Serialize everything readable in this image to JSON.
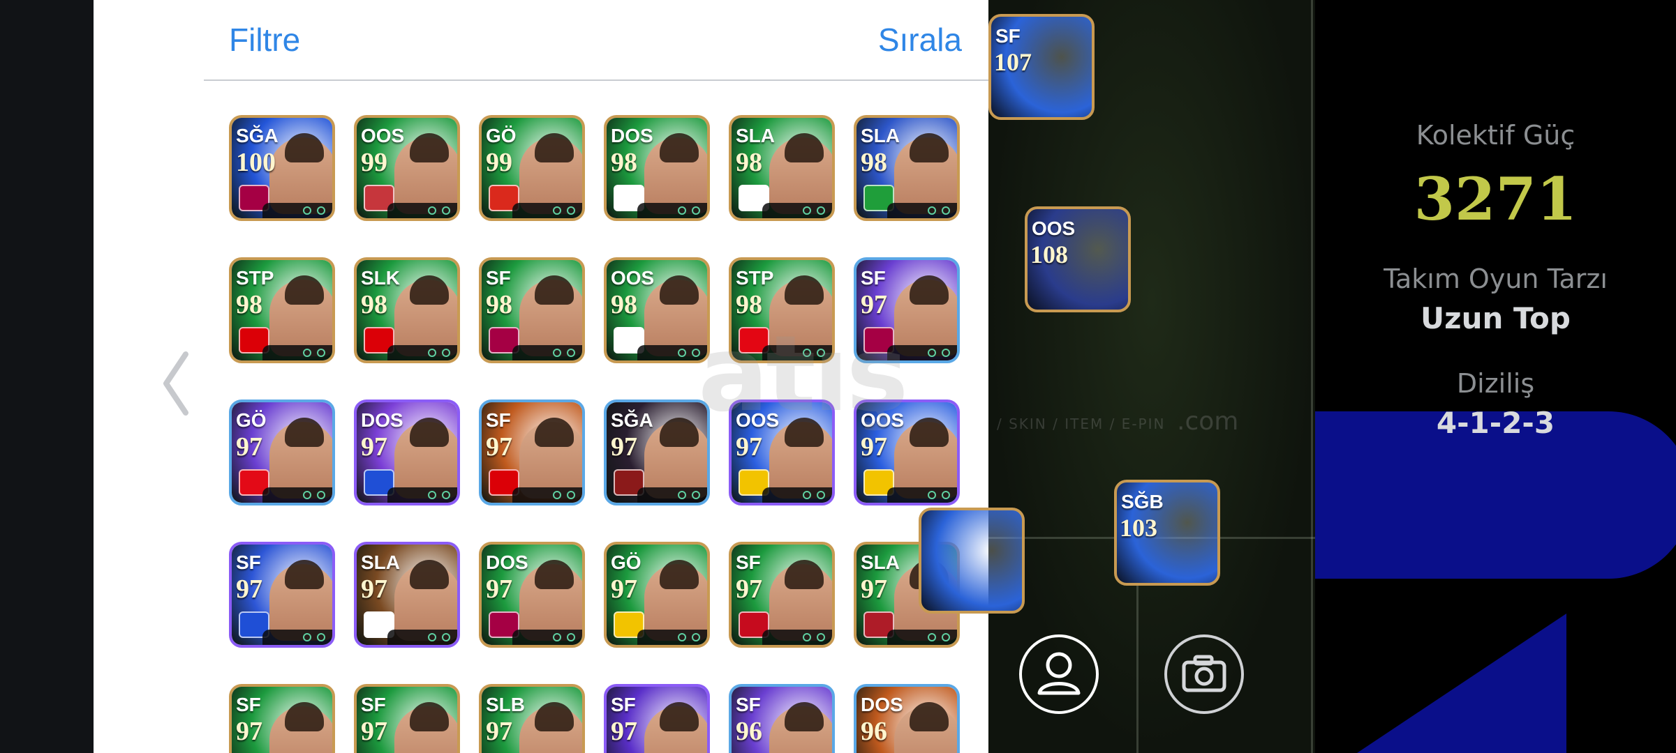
{
  "panel": {
    "filter_label": "Filtre",
    "sort_label": "Sırala"
  },
  "cards": [
    {
      "pos": "SĞA",
      "rating": "100",
      "bg": "#2355d8",
      "frame": "#c89a52",
      "emblem": "#a50044"
    },
    {
      "pos": "OOS",
      "rating": "99",
      "bg": "#1c9a3e",
      "frame": "#c89a52",
      "emblem": "#c6363c"
    },
    {
      "pos": "GÖ",
      "rating": "99",
      "bg": "#1c9a3e",
      "frame": "#c89a52",
      "emblem": "#da291c"
    },
    {
      "pos": "DOS",
      "rating": "98",
      "bg": "#1c9a3e",
      "frame": "#c89a52",
      "emblem": "#ffffff"
    },
    {
      "pos": "SLA",
      "rating": "98",
      "bg": "#1c9a3e",
      "frame": "#c89a52",
      "emblem": "#ffffff"
    },
    {
      "pos": "SLA",
      "rating": "98",
      "bg": "#2d56c9",
      "frame": "#c89a52",
      "emblem": "#1f9e3a"
    },
    {
      "pos": "STP",
      "rating": "98",
      "bg": "#1c9a3e",
      "frame": "#c89a52",
      "emblem": "#db0007"
    },
    {
      "pos": "SLK",
      "rating": "98",
      "bg": "#1c9a3e",
      "frame": "#c89a52",
      "emblem": "#db0007"
    },
    {
      "pos": "SF",
      "rating": "98",
      "bg": "#1c9a3e",
      "frame": "#c89a52",
      "emblem": "#a50044"
    },
    {
      "pos": "OOS",
      "rating": "98",
      "bg": "#1c9a3e",
      "frame": "#c89a52",
      "emblem": "#ffffff"
    },
    {
      "pos": "STP",
      "rating": "98",
      "bg": "#1c9a3e",
      "frame": "#c89a52",
      "emblem": "#e30613"
    },
    {
      "pos": "SF",
      "rating": "97",
      "bg": "#6a3fd1",
      "frame": "#5aa8e6",
      "emblem": "#a50044"
    },
    {
      "pos": "GÖ",
      "rating": "97",
      "bg": "#6a3fd1",
      "frame": "#5aa8e6",
      "emblem": "#e30a17"
    },
    {
      "pos": "DOS",
      "rating": "97",
      "bg": "#7b3fd6",
      "frame": "#8b5cf6",
      "emblem": "#1f4fd6"
    },
    {
      "pos": "SF",
      "rating": "97",
      "bg": "#c05a1e",
      "frame": "#5aa8e6",
      "emblem": "#db0007"
    },
    {
      "pos": "SĞA",
      "rating": "97",
      "bg": "#2a1e30",
      "frame": "#5aa8e6",
      "emblem": "#8b1a1a"
    },
    {
      "pos": "OOS",
      "rating": "97",
      "bg": "#2b5fe0",
      "frame": "#8b5cf6",
      "emblem": "#f2c300"
    },
    {
      "pos": "OOS",
      "rating": "97",
      "bg": "#2b5fe0",
      "frame": "#8b5cf6",
      "emblem": "#f2c300"
    },
    {
      "pos": "SF",
      "rating": "97",
      "bg": "#2d56d6",
      "frame": "#8b5cf6",
      "emblem": "#1f4fd6"
    },
    {
      "pos": "SLA",
      "rating": "97",
      "bg": "#7a4a22",
      "frame": "#8b5cf6",
      "emblem": "#ffffff"
    },
    {
      "pos": "DOS",
      "rating": "97",
      "bg": "#1c9a3e",
      "frame": "#c89a52",
      "emblem": "#a50044"
    },
    {
      "pos": "GÖ",
      "rating": "97",
      "bg": "#1c9a3e",
      "frame": "#c89a52",
      "emblem": "#f2c300"
    },
    {
      "pos": "SF",
      "rating": "97",
      "bg": "#1c9a3e",
      "frame": "#c89a52",
      "emblem": "#c60b1e"
    },
    {
      "pos": "SLA",
      "rating": "97",
      "bg": "#1c9a3e",
      "frame": "#c89a52",
      "emblem": "#ae1c28"
    },
    {
      "pos": "SF",
      "rating": "97",
      "bg": "#1c9a3e",
      "frame": "#c89a52",
      "emblem": "#db0007"
    },
    {
      "pos": "SF",
      "rating": "97",
      "bg": "#1c9a3e",
      "frame": "#c89a52",
      "emblem": "#a50044"
    },
    {
      "pos": "SLB",
      "rating": "97",
      "bg": "#1c9a3e",
      "frame": "#c89a52",
      "emblem": "#a50044"
    },
    {
      "pos": "SF",
      "rating": "97",
      "bg": "#5a2fc9",
      "frame": "#8b5cf6",
      "emblem": "#1f4fd6"
    },
    {
      "pos": "SF",
      "rating": "96",
      "bg": "#6a3fd1",
      "frame": "#5aa8e6",
      "emblem": "#1f4fd6"
    },
    {
      "pos": "DOS",
      "rating": "96",
      "bg": "#c05a1e",
      "frame": "#5aa8e6",
      "emblem": "#db0007"
    }
  ],
  "field_cards": [
    {
      "pos": "SF",
      "rating": "107",
      "bg": "#2b63d8"
    },
    {
      "pos": "OOS",
      "rating": "108",
      "bg": "#2a3c8c"
    },
    {
      "pos": "SĞB",
      "rating": "103",
      "bg": "#2b63d8"
    }
  ],
  "watermark": {
    "main": "atış",
    "sub": "/ SKIN / ITEM / E-PIN",
    "com": ".com"
  },
  "team": {
    "power_label": "Kolektif Güç",
    "power_value": "3271",
    "style_label": "Takım Oyun Tarzı",
    "style_value": "Uzun Top",
    "formation_label": "Diziliş",
    "formation_value": "4-1-2-3"
  },
  "icons": {
    "back": "chevron-left-icon",
    "profile": "person-icon",
    "camera": "camera-icon"
  },
  "colors": {
    "accent": "#2f86e6",
    "power": "#c2c84a",
    "gold_frame": "#c89a52"
  }
}
